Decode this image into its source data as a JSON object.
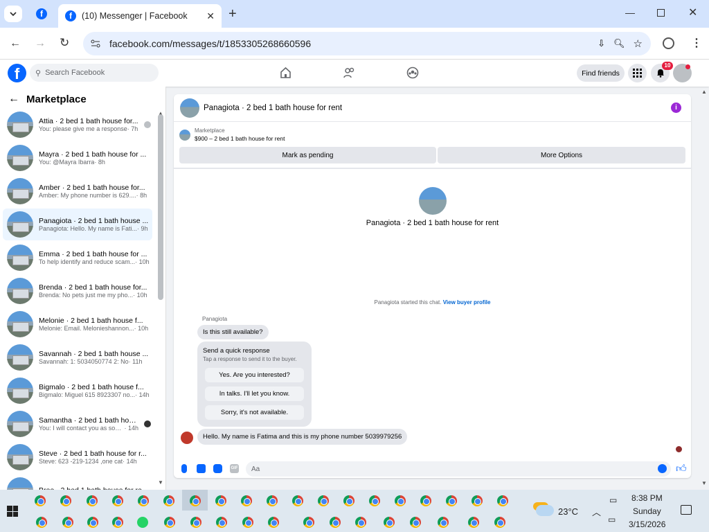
{
  "browser": {
    "tab_title": "(10) Messenger | Facebook",
    "url": "facebook.com/messages/t/1853305268660596"
  },
  "facebook": {
    "search_placeholder": "Search Facebook",
    "find_friends": "Find friends",
    "notification_count": "10"
  },
  "sidebar": {
    "title": "Marketplace",
    "conversations": [
      {
        "name": "Attia · 2 bed 1 bath house for...",
        "snippet": "You: please give me a response",
        "time": "· 7h"
      },
      {
        "name": "Mayra · 2 bed 1 bath house for ...",
        "snippet": "You: @Mayra Ibarra",
        "time": "· 8h"
      },
      {
        "name": "Amber · 2 bed 1 bath house for...",
        "snippet": "Amber: My phone number is 629....",
        "time": "· 8h"
      },
      {
        "name": "Panagiota · 2 bed 1 bath house ...",
        "snippet": "Panagiota: Hello. My name is Fati...",
        "time": "· 9h"
      },
      {
        "name": "Emma · 2 bed 1 bath house for ...",
        "snippet": "To help identify and reduce scam...",
        "time": "· 10h"
      },
      {
        "name": "Brenda · 2 bed 1 bath house for...",
        "snippet": "Brenda: No pets just me my pho...",
        "time": "· 10h"
      },
      {
        "name": "Melonie · 2 bed 1 bath house f...",
        "snippet": "Melonie: Email. Melonieshannon...",
        "time": "· 10h"
      },
      {
        "name": "Savannah · 2 bed 1 bath house ...",
        "snippet": "Savannah: 1: 5034050774 2: No",
        "time": "· 11h"
      },
      {
        "name": "Bigmalo · 2 bed 1 bath house f...",
        "snippet": "Bigmalo: Miguel 615 8923307 no...",
        "time": "· 14h"
      },
      {
        "name": "Samantha · 2 bed 1 bath hou...",
        "snippet": "You: I will contact you as soon...",
        "time": "· 14h"
      },
      {
        "name": "Steve · 2 bed 1 bath house for r...",
        "snippet": "Steve: 623 -219-1234 ,one cat",
        "time": "· 14h"
      },
      {
        "name": "Bree · 2 bed 1 bath house for re...",
        "snippet": "",
        "time": ""
      }
    ]
  },
  "chat": {
    "title": "Panagiota · 2 bed 1 bath house for rent",
    "marketplace_label": "Marketplace",
    "listing": "$900 – 2 bed 1 bath house for rent",
    "mark_pending": "Mark as pending",
    "more_options": "More Options",
    "profile_name": "Panagiota · 2 bed 1 bath house for rent",
    "started_text": "Panagiota started this chat.",
    "view_buyer": "View buyer profile",
    "sender": "Panagiota",
    "first_message": "Is this still available?",
    "quick_title": "Send a quick response",
    "quick_sub": "Tap a response to send it to the buyer.",
    "quick_replies": [
      "Yes. Are you interested?",
      "In talks. I'll let you know.",
      "Sorry, it's not available."
    ],
    "second_message": "Hello. My name is Fatima and this is my phone number 5039979256",
    "composer_placeholder": "Aa"
  },
  "taskbar": {
    "temperature": "23°C",
    "time": "8:38 PM",
    "day": "Sunday",
    "date": "3/15/2026"
  },
  "colors": {
    "facebook_blue": "#0866ff",
    "selected_conv": "#ebf5ff",
    "info_purple": "#9b28d6"
  }
}
